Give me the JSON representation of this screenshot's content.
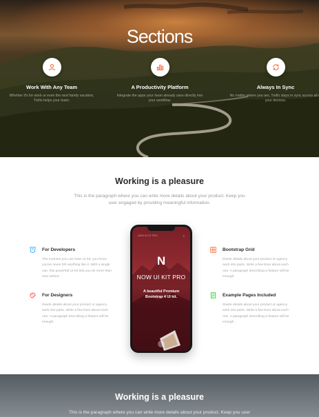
{
  "hero": {
    "title": "Sections",
    "features": [
      {
        "icon": "user-icon",
        "title": "Work With Any Team",
        "text": "Whether it's for work or even the next family vacation, Trello helps your team."
      },
      {
        "icon": "chart-bar-icon",
        "title": "A Productivity Platform",
        "text": "Integrate the apps your team already uses directly into your workflow."
      },
      {
        "icon": "sync-icon",
        "title": "Always In Sync",
        "text": "No matter where you are, Trello stays in sync across all of your devices."
      }
    ]
  },
  "main": {
    "title": "Working is a pleasure",
    "paragraph": "This is the paragraph where you can write more details about your product. Keep you user engaged by providing meaningful information.",
    "left_features": [
      {
        "icon": "html5-icon",
        "title": "For Developers",
        "text": "The moment you use Now UI Kit, you know you've never felt anything like it. With a single use, this powerfull UI Kit lets you do more than ever before."
      },
      {
        "icon": "palette-icon",
        "title": "For Designers",
        "text": "Divide details about your product or agency work into parts. Write a few lines about each one. A paragraph describing a feature will be enough."
      }
    ],
    "right_features": [
      {
        "icon": "grid-icon",
        "title": "Bootstrap Grid",
        "text": "Divide details about your product or agency work into parts. Write a few lines about each one. A paragraph describing a feature will be enough."
      },
      {
        "icon": "pages-icon",
        "title": "Example Pages Included",
        "text": "Divide details about your product or agency work into parts. Write a few lines about each one. A paragraph describing a feature will be enough."
      }
    ],
    "phone": {
      "header_label": "NOW UI KIT PRO",
      "menu_icon": "menu-icon",
      "logo_letter": "N",
      "kit_name": "NOW UI KIT PRO",
      "tagline": "A beautiful Premium Bootstrap 4 UI kit."
    }
  },
  "bottom": {
    "title": "Working is a pleasure",
    "paragraph": "This is the paragraph where you can write more details about your product. Keep you user"
  },
  "colors": {
    "accent_orange": "#f96332",
    "blue": "#2ca8ff",
    "red": "#ff3636",
    "green": "#18ce0f"
  }
}
